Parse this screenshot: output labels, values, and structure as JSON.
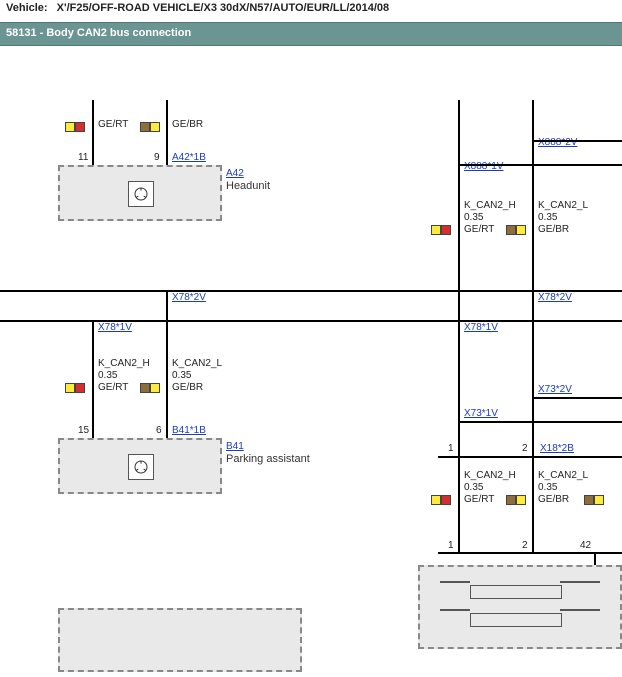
{
  "vehicle_label": "Vehicle:",
  "vehicle": "X'/F25/OFF-ROAD VEHICLE/X3 30dX/N57/AUTO/EUR/LL/2014/08",
  "title": "58131  -  Body CAN2 bus connection",
  "components": {
    "a42": {
      "ref": "A42",
      "conn": "A42*1B",
      "desc": "Headunit"
    },
    "b41": {
      "ref": "B41",
      "conn": "B41*1B",
      "desc": "Parking assistant"
    }
  },
  "splices": {
    "x78_1": "X78*1V",
    "x78_2": "X78*2V",
    "x888_1": "X888*1V",
    "x888_2": "X888*2V",
    "x73_1": "X73*1V",
    "x73_2": "X73*2V",
    "x18_2b": "X18*2B"
  },
  "signals": {
    "can_h": "K_CAN2_H",
    "can_l": "K_CAN2_L",
    "gauge": "0.35",
    "ge_rt": "GE/RT",
    "ge_br": "GE/BR"
  },
  "pins": {
    "a42_h": "11",
    "a42_l": "9",
    "b41_h": "15",
    "b41_l": "6",
    "x18_h_top": "1",
    "x18_l_top": "2",
    "x18_h_bot": "1",
    "x18_l_bot": "2",
    "x18_42": "42"
  }
}
